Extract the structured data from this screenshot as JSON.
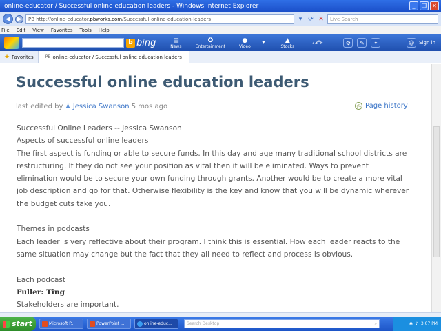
{
  "window": {
    "title": "online-educator / Successful online education leaders - Windows Internet Explorer"
  },
  "address": {
    "url_prefix": "PB http://online-educator.",
    "url_host": "pbworks.com",
    "url_suffix": "/Successful-online-education-leaders",
    "search_placeholder": "Live Search"
  },
  "menu": [
    "File",
    "Edit",
    "View",
    "Favorites",
    "Tools",
    "Help"
  ],
  "toolbar": {
    "brand": "bing",
    "items": [
      {
        "label": "News",
        "icon": "news-icon"
      },
      {
        "label": "Entertainment",
        "icon": "entertainment-icon"
      },
      {
        "label": "Video",
        "icon": "video-icon"
      },
      {
        "label": "Stocks",
        "icon": "stocks-icon"
      }
    ],
    "temperature": "73°F",
    "signin": "Sign in"
  },
  "favorites": {
    "label": "Favorites",
    "tab_prefix": "PB",
    "tab_title": "online-educator / Successful online education leaders"
  },
  "page": {
    "title": "Successful online education leaders",
    "meta_prefix": "last edited by",
    "author": "Jessica Swanson",
    "edited_ago": "5 mos ago",
    "history_link": "Page history",
    "lines": {
      "l1": "Successful Online Leaders -- Jessica Swanson",
      "l2": "Aspects of successful online leaders",
      "p1": "The first aspect is funding or able to secure funds. In this day and age many traditional school districts are restructuring. If they do not see your position as vital then it will be eliminated. Ways to prevent elimination would be to secure your own funding through grants. Another would be to create a more vital job description and go for that. Otherwise flexibility is the key and know that you will be dynamic wherever the budget cuts take you.",
      "h2": "Themes in podcasts",
      "p2": "Each leader is very reflective about their program. I think this is essential. How each leader reacts to the same situation may change but the fact that they all need to reflect and process is obvious.",
      "h3": "Each podcast",
      "bold": "Fuller:  Ting",
      "p3": "Stakeholders are important."
    }
  },
  "taskbar": {
    "start": "start",
    "tasks": [
      "Microsoft P...",
      "PowerPoint ...",
      "online-educ..."
    ],
    "search_placeholder": "Search Desktop",
    "clock": "3:07 PM"
  },
  "colors": {
    "title_text": "#3d5a73",
    "link": "#3a74c7",
    "taskbar": "#1d55c7",
    "start": "#2e8c2a"
  }
}
